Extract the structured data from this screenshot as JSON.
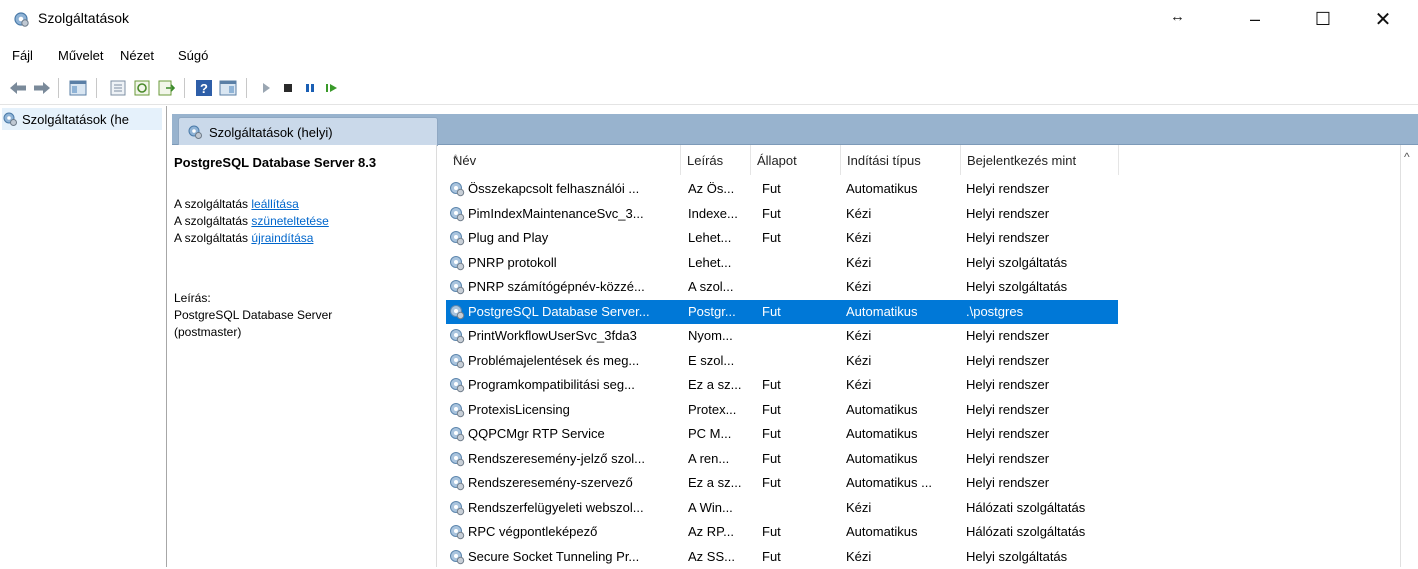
{
  "window": {
    "title": "Szolgáltatások",
    "resize_glyph": "↔",
    "minimize": "–",
    "maximize": "☐",
    "close": "✕"
  },
  "menu": [
    "Fájl",
    "Művelet",
    "Nézet",
    "Súgó"
  ],
  "tree": {
    "item_label": "Szolgáltatások (he"
  },
  "tab": {
    "label": "Szolgáltatások (helyi)"
  },
  "detail": {
    "service_name": "PostgreSQL Database Server 8.3",
    "stop_prefix": "A szolgáltatás ",
    "stop_link": "leállítása",
    "pause_prefix": "A szolgáltatás ",
    "pause_link": "szüneteltetése",
    "restart_prefix": "A szolgáltatás ",
    "restart_link": "újraindítása",
    "desc_label": "Leírás:",
    "desc_line1": "PostgreSQL Database Server",
    "desc_line2": "(postmaster)"
  },
  "columns": {
    "name": "Név",
    "desc": "Leírás",
    "status": "Állapot",
    "startup": "Indítási típus",
    "logon": "Bejelentkezés mint"
  },
  "rows": [
    {
      "name": "Összekapcsolt felhasználói ...",
      "desc": "Az Ös...",
      "status": "Fut",
      "startup": "Automatikus",
      "logon": "Helyi rendszer"
    },
    {
      "name": "PimIndexMaintenanceSvc_3...",
      "desc": "Indexe...",
      "status": "Fut",
      "startup": "Kézi",
      "logon": "Helyi rendszer"
    },
    {
      "name": "Plug and Play",
      "desc": "Lehet...",
      "status": "Fut",
      "startup": "Kézi",
      "logon": "Helyi rendszer"
    },
    {
      "name": "PNRP protokoll",
      "desc": "Lehet...",
      "status": "",
      "startup": "Kézi",
      "logon": "Helyi szolgáltatás"
    },
    {
      "name": "PNRP számítógépnév-közzé...",
      "desc": "A szol...",
      "status": "",
      "startup": "Kézi",
      "logon": "Helyi szolgáltatás"
    },
    {
      "name": "PostgreSQL Database Server...",
      "desc": "Postgr...",
      "status": "Fut",
      "startup": "Automatikus",
      "logon": ".\\postgres",
      "selected": true
    },
    {
      "name": "PrintWorkflowUserSvc_3fda3",
      "desc": "Nyom...",
      "status": "",
      "startup": "Kézi",
      "logon": "Helyi rendszer"
    },
    {
      "name": "Problémajelentések és meg...",
      "desc": "E szol...",
      "status": "",
      "startup": "Kézi",
      "logon": "Helyi rendszer"
    },
    {
      "name": "Programkompatibilitási seg...",
      "desc": "Ez a sz...",
      "status": "Fut",
      "startup": "Kézi",
      "logon": "Helyi rendszer"
    },
    {
      "name": "ProtexisLicensing",
      "desc": "Protex...",
      "status": "Fut",
      "startup": "Automatikus",
      "logon": "Helyi rendszer"
    },
    {
      "name": "QQPCMgr RTP Service",
      "desc": "PC M...",
      "status": "Fut",
      "startup": "Automatikus",
      "logon": "Helyi rendszer"
    },
    {
      "name": "Rendszeresemény-jelző szol...",
      "desc": "A ren...",
      "status": "Fut",
      "startup": "Automatikus",
      "logon": "Helyi rendszer"
    },
    {
      "name": "Rendszeresemény-szervező",
      "desc": "Ez a sz...",
      "status": "Fut",
      "startup": "Automatikus ...",
      "logon": "Helyi rendszer"
    },
    {
      "name": "Rendszerfelügyeleti webszol...",
      "desc": "A Win...",
      "status": "",
      "startup": "Kézi",
      "logon": "Hálózati szolgáltatás"
    },
    {
      "name": "RPC végpontleképező",
      "desc": "Az RP...",
      "status": "Fut",
      "startup": "Automatikus",
      "logon": "Hálózati szolgáltatás"
    },
    {
      "name": "Secure Socket Tunneling Pr...",
      "desc": "Az SS...",
      "status": "Fut",
      "startup": "Kézi",
      "logon": "Helyi szolgáltatás"
    }
  ],
  "colors": {
    "selection": "#0078d7",
    "header_band": "#98b3ce",
    "link": "#0066cc"
  }
}
